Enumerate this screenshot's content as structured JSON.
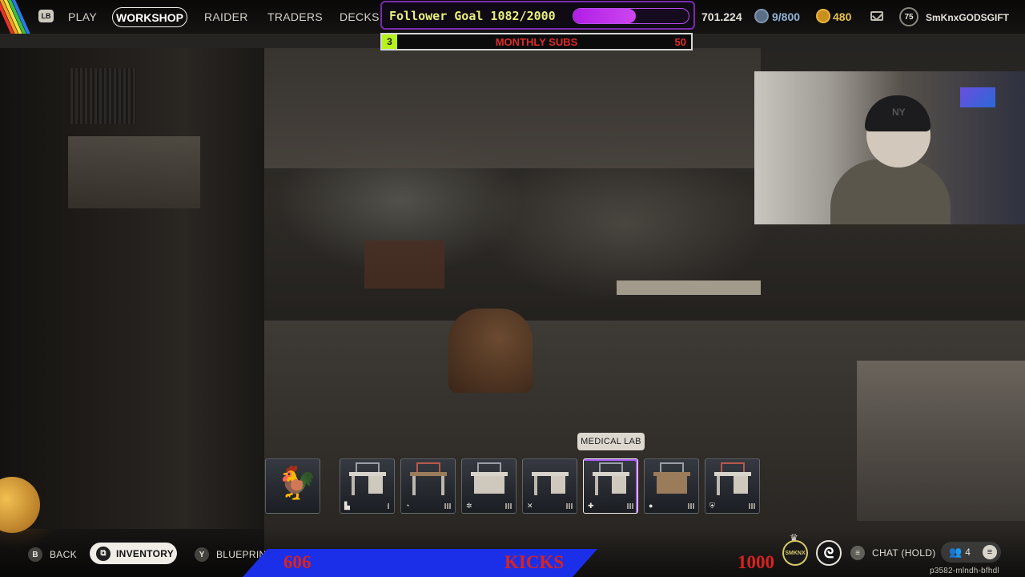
{
  "nav": {
    "lb_key": "LB",
    "items": [
      "PLAY",
      "WORKSHOP",
      "RAIDER",
      "TRADERS",
      "DECKS"
    ],
    "active": "WORKSHOP"
  },
  "stats": {
    "currency_main": "701.224",
    "currency_blue": "9/800",
    "currency_gold": "480",
    "level": "75",
    "username": "SmKnxGODSGIFT"
  },
  "overlay": {
    "follower_goal": "Follower Goal 1082/2000",
    "follower_current": 1082,
    "follower_target": 2000,
    "subs_count": "3",
    "subs_label": "MONTHLY SUBS",
    "subs_target": "50"
  },
  "tooltip": "MEDICAL LAB",
  "hotbar": [
    {
      "name": "rooster",
      "icon": "rooster-icon"
    },
    {
      "name": "workbench",
      "icon": "bench-icon"
    },
    {
      "name": "gunsmith",
      "icon": "gun-icon"
    },
    {
      "name": "refiner",
      "icon": "recycle-icon"
    },
    {
      "name": "utility-station",
      "icon": "tools-icon"
    },
    {
      "name": "medical-lab",
      "icon": "plus-icon",
      "selected": true
    },
    {
      "name": "explosives-station",
      "icon": "bomb-icon"
    },
    {
      "name": "gear-bench",
      "icon": "shield-icon"
    }
  ],
  "bottom": {
    "back_key": "B",
    "back_label": "BACK",
    "inventory_label": "INVENTORY",
    "blueprint_key": "Y",
    "blueprint_label": "BLUEPRINT",
    "kicks_left": "606",
    "kicks_label": "KICKS",
    "kicks_right": "1000",
    "smknx_logo": "SMKNX",
    "chat_label": "CHAT (HOLD)",
    "friends_count": "4",
    "session_id": "p3582-mlndh-bfhdl"
  },
  "colors": {
    "goal_purple": "#b21ee6",
    "subs_green": "#b6f21c",
    "subs_red": "#e02a2a",
    "kicks_blue": "#1c2fe8"
  }
}
